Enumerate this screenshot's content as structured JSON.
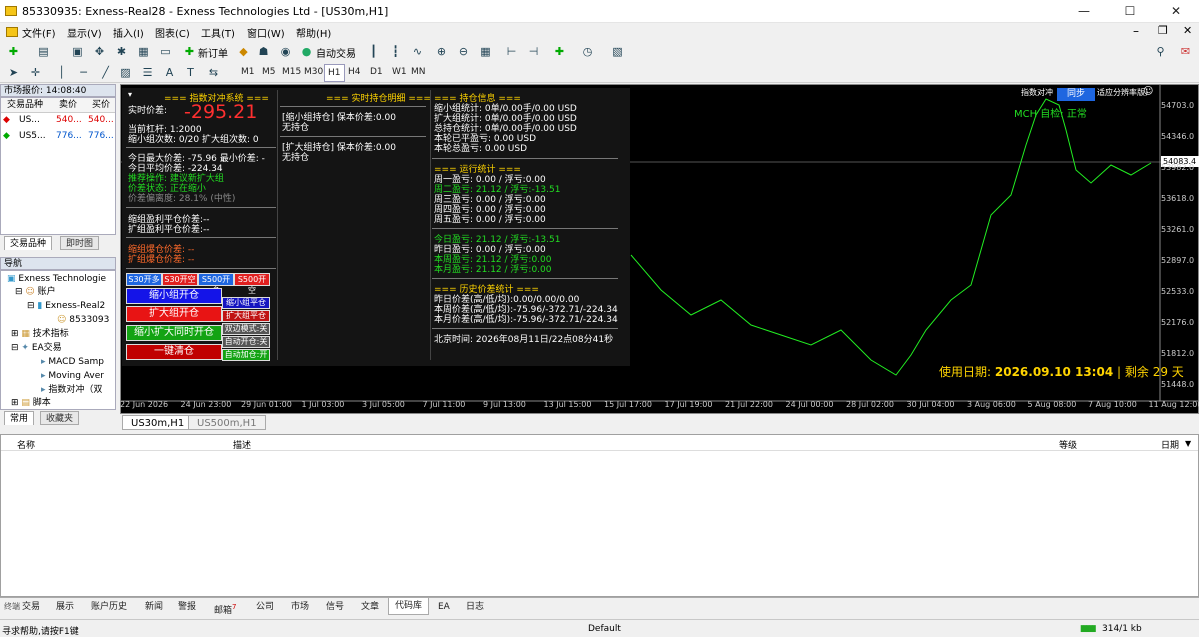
{
  "window": {
    "title": "85330935: Exness-Real28 - Exness Technologies Ltd - [US30m,H1]",
    "min": "—",
    "max": "☐",
    "close": "✕"
  },
  "menu": [
    "文件(F)",
    "显示(V)",
    "插入(I)",
    "图表(C)",
    "工具(T)",
    "窗口(W)",
    "帮助(H)"
  ],
  "toolbar": {
    "new_order": "新订单",
    "auto_trade": "自动交易"
  },
  "timeframes": [
    "M1",
    "M5",
    "M15",
    "M30",
    "H1",
    "H4",
    "D1",
    "W1",
    "MN"
  ],
  "market_watch": {
    "title": "市场报价: 14:08:40",
    "cols": [
      "交易品种",
      "卖价",
      "买价"
    ],
    "rows": [
      {
        "sym": "US...",
        "bid": "540...",
        "ask": "540..."
      },
      {
        "sym": "US5...",
        "bid": "776...",
        "ask": "776..."
      }
    ],
    "tabs": [
      "交易品种",
      "即时图"
    ]
  },
  "navigator": {
    "title": "导航",
    "items": [
      "Exness Technologie",
      "账户",
      "Exness-Real2",
      "8533093",
      "技术指标",
      "EA交易",
      "MACD Samp",
      "Moving Aver",
      "指数对冲（双",
      "脚本"
    ],
    "tabs": [
      "常用",
      "收藏夹"
    ]
  },
  "ea": {
    "sys_title": "=== 指数对冲系统 ===",
    "spread_label": "实时价差:",
    "spread_value": "-295.21",
    "lev": "当前杠杆:   1:2000",
    "count": "缩小组次数: 0/20     扩大组次数: 0",
    "max_diff": "今日最大价差: -75.96   最小价差: -",
    "avg_diff": "今日平均价差: -224.34",
    "rec": "推荐操作:    建议新扩大组",
    "state": "价差状态:    正在缩小",
    "dev": "价差偏离度:  28.1% (中性)",
    "tp_small": "缩组盈利平仓价差:--",
    "tp_big": "扩组盈利平仓价差:--",
    "blow_small": "缩组爆仓价差: --",
    "blow_big": "扩组爆仓价差: --",
    "sym_btns": [
      "S30开多",
      "S30开空",
      "S500开多",
      "S500开空"
    ],
    "main_btns": [
      "缩小组开仓",
      "扩大组开仓",
      "缩小扩大同时开仓",
      "一键清仓"
    ],
    "side_btns": [
      "缩小组平仓",
      "扩大组平仓",
      "双边模式:关",
      "自动开仓:关",
      "自动加仓:开"
    ],
    "detail_title": "=== 实时持仓明细 ===",
    "detail1": "[缩小组持仓] 保本价差:0.00",
    "detail1b": "无持仓",
    "detail2": "[扩大组持仓] 保本价差:0.00",
    "detail2b": "无持仓",
    "pos_title": "=== 持仓信息 ===",
    "pos": [
      "缩小组统计: 0单/0.00手/0.00 USD",
      "扩大组统计: 0单/0.00手/0.00 USD",
      "总持仓统计: 0单/0.00手/0.00 USD",
      "本轮已平盈亏: 0.00 USD",
      "本轮总盈亏:   0.00 USD"
    ],
    "run_title": "=== 运行统计 ===",
    "run": [
      "周一盈亏:   0.00 / 浮亏:0.00",
      "周二盈亏:   21.12 / 浮亏:-13.51",
      "周三盈亏:   0.00 / 浮亏:0.00",
      "周四盈亏:   0.00 / 浮亏:0.00",
      "周五盈亏:   0.00 / 浮亏:0.00"
    ],
    "run2": [
      "今日盈亏:   21.12 / 浮亏:-13.51",
      "昨日盈亏:   0.00 / 浮亏:0.00",
      "本周盈亏:   21.12 / 浮亏:0.00",
      "本月盈亏:   21.12 / 浮亏:0.00"
    ],
    "hist_title": "=== 历史价差统计 ===",
    "hist": [
      "昨日价差(高/低/均):0.00/0.00/0.00",
      "本周价差(高/低/均):-75.96/-372.71/-224.34",
      "本月价差(高/低/均):-75.96/-372.71/-224.34"
    ],
    "beijing": "北京时间:    2026年08月11日/22点08分41秒"
  },
  "chart": {
    "ea_label": "指数对冲（",
    "sync": "同步",
    "ea_label2": "适应分辨率版）",
    "mch": "MCH 自检: 正常",
    "expire_label": "使用日期:",
    "expire_date": "2026.09.10 13:04",
    "expire_sep": "|",
    "remain": "剩余 29 天",
    "price_tag": "54083.4",
    "yticks": [
      "54703.0",
      "54346.0",
      "53982.0",
      "53618.0",
      "53261.0",
      "52897.0",
      "52533.0",
      "52176.0",
      "51812.0",
      "51448.0"
    ],
    "xticks": [
      "22 Jun 2026",
      "24 Jun 23:00",
      "29 Jun 01:00",
      "1 Jul 03:00",
      "3 Jul 05:00",
      "7 Jul 11:00",
      "9 Jul 13:00",
      "13 Jul 15:00",
      "15 Jul 17:00",
      "17 Jul 19:00",
      "21 Jul 22:00",
      "24 Jul 00:00",
      "28 Jul 02:00",
      "30 Jul 04:00",
      "3 Aug 06:00",
      "5 Aug 08:00",
      "7 Aug 10:00",
      "11 Aug 12:00"
    ]
  },
  "chart_tabs": [
    "US30m,H1",
    "US500m,H1"
  ],
  "terminal": {
    "cols": [
      "名称",
      "描述",
      "等级",
      "日期"
    ]
  },
  "bottom_tabs": [
    "交易",
    "展示",
    "账户历史",
    "新闻",
    "警报",
    "邮箱",
    "公司",
    "市场",
    "信号",
    "文章",
    "代码库",
    "EA",
    "日志"
  ],
  "mail_badge": "7",
  "status": {
    "help": "寻求帮助,请按F1键",
    "profile": "Default",
    "traffic": "314/1 kb"
  }
}
